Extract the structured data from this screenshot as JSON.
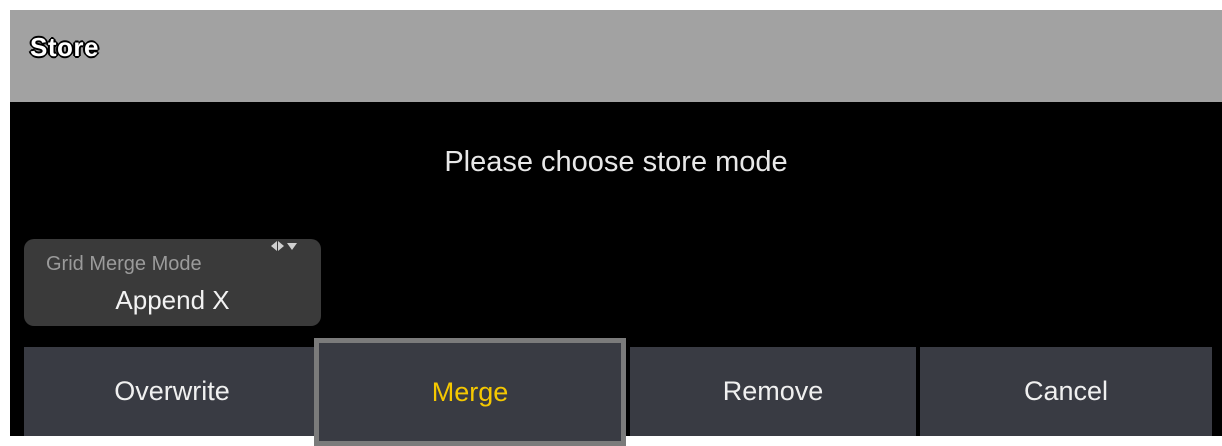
{
  "dialog": {
    "title": "Store",
    "prompt": "Please choose store mode"
  },
  "grid_merge_mode": {
    "label": "Grid Merge Mode",
    "value": "Append X"
  },
  "buttons": {
    "overwrite": "Overwrite",
    "merge": "Merge",
    "remove": "Remove",
    "cancel": "Cancel"
  },
  "colors": {
    "titlebar": "#a2a2a2",
    "background": "#000000",
    "button": "#393b43",
    "selected_text": "#f5c800",
    "selected_border": "#7b7b7b"
  },
  "selected_button": "merge"
}
